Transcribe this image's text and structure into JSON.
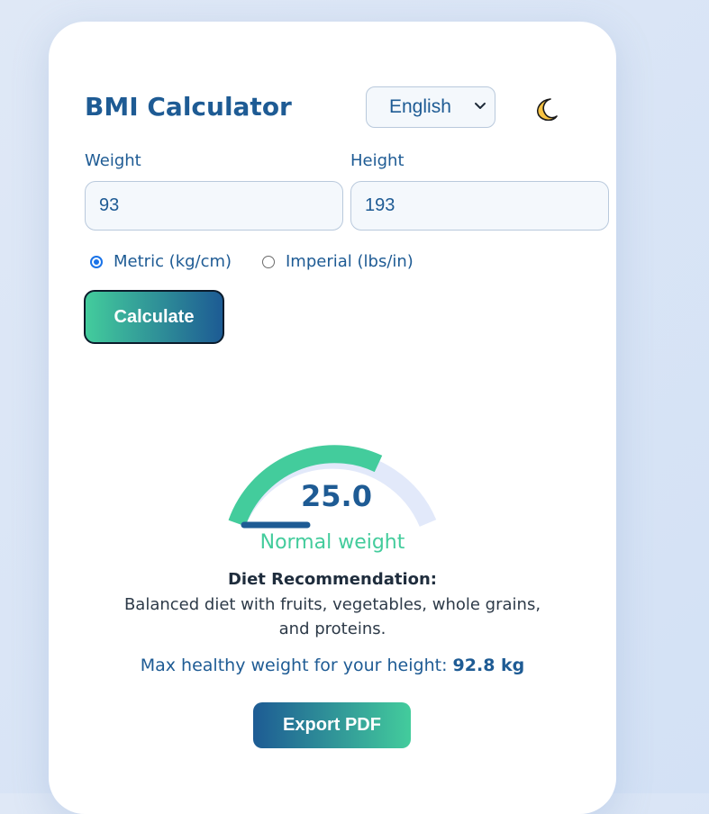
{
  "app": {
    "title": "BMI Calculator",
    "language_selected": "English",
    "theme_toggle_icon": "moon-icon"
  },
  "form": {
    "weight_label": "Weight",
    "weight_value": "93",
    "height_label": "Height",
    "height_value": "193",
    "units": [
      {
        "label": "Metric (kg/cm)",
        "selected": true
      },
      {
        "label": "Imperial (lbs/in)",
        "selected": false
      }
    ],
    "calculate_label": "Calculate"
  },
  "result": {
    "bmi": "25.0",
    "bmi_number": 25.0,
    "category": "Normal weight",
    "diet_title": "Diet Recommendation:",
    "diet_text": "Balanced diet with fruits, vegetables, whole grains, and proteins.",
    "max_weight_prefix": "Max healthy weight for your height:",
    "max_weight_value": "92.8 kg",
    "export_label": "Export PDF"
  },
  "colors": {
    "brand": "#1e5b94",
    "accent": "#43cc9c",
    "gauge_track": "#e2e9fa"
  }
}
